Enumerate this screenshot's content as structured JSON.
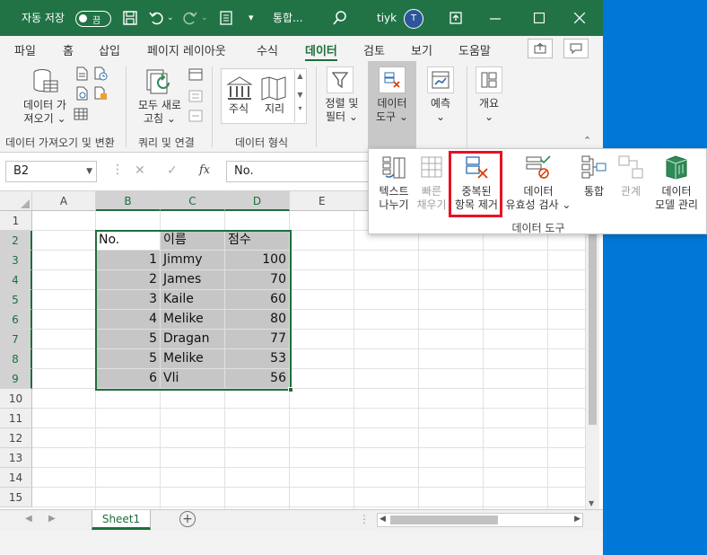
{
  "titlebar": {
    "autosave_label": "자동 저장",
    "autosave_state": "끔",
    "doc_title": "통합...",
    "user_name": "tiyk",
    "avatar_initial": "T"
  },
  "tabs": [
    {
      "label": "파일"
    },
    {
      "label": "홈"
    },
    {
      "label": "삽입"
    },
    {
      "label": "페이지 레이아웃"
    },
    {
      "label": "수식"
    },
    {
      "label": "데이터"
    },
    {
      "label": "검토"
    },
    {
      "label": "보기"
    },
    {
      "label": "도움말"
    }
  ],
  "ribbon": {
    "get_data_line1": "데이터 가",
    "get_data_line2": "져오기",
    "refresh_line1": "모두 새로",
    "refresh_line2": "고침",
    "stocks": "주식",
    "geography": "지리",
    "sort_line1": "정렬 및",
    "sort_line2": "필터",
    "data_tools_line1": "데이터",
    "data_tools_line2": "도구",
    "forecast": "예측",
    "outline": "개요",
    "group_get_data": "데이터 가져오기 및 변환",
    "group_queries": "쿼리 및 연결",
    "group_data_types": "데이터 형식"
  },
  "formula": {
    "namebox": "B2",
    "content": "No."
  },
  "popup": {
    "text_to_columns_1": "텍스트",
    "text_to_columns_2": "나누기",
    "flash_fill_1": "빠른",
    "flash_fill_2": "채우기",
    "remove_dup_1": "중복된",
    "remove_dup_2": "항목 제거",
    "validation_1": "데이터",
    "validation_2": "유효성 검사",
    "consolidate": "통합",
    "relationships": "관계",
    "data_model_1": "데이터",
    "data_model_2": "모델 관리",
    "group_label": "데이터 도구"
  },
  "columns": [
    "A",
    "B",
    "C",
    "D",
    "E"
  ],
  "rows": [
    "1",
    "2",
    "3",
    "4",
    "5",
    "6",
    "7",
    "8",
    "9",
    "10",
    "11",
    "12",
    "13",
    "14",
    "15"
  ],
  "table": {
    "headers": [
      "No.",
      "이름",
      "점수"
    ],
    "data": [
      [
        "1",
        "Jimmy",
        "100"
      ],
      [
        "2",
        "James",
        "70"
      ],
      [
        "3",
        "Kaile",
        "60"
      ],
      [
        "4",
        "Melike",
        "80"
      ],
      [
        "5",
        "Dragan",
        "77"
      ],
      [
        "5",
        "Melike",
        "53"
      ],
      [
        "6",
        "Vli",
        "56"
      ]
    ]
  },
  "sheet": {
    "tab": "Sheet1"
  }
}
